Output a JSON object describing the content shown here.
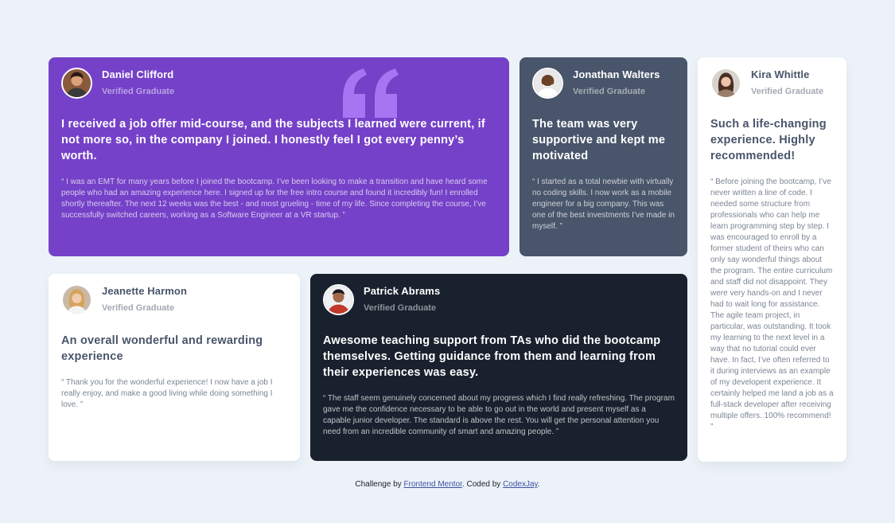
{
  "colors": {
    "background": "#ecf2f8",
    "purple": "#7541c8",
    "slate": "#48556a",
    "dark": "#19212e",
    "white": "#ffffff",
    "link": "#3e52a3",
    "quote_mark": "#a775f1"
  },
  "testimonials": [
    {
      "name": "Daniel Clifford",
      "title": "Verified Graduate",
      "avatar_icon": "avatar-daniel-icon",
      "headline": "I received a job offer mid-course, and the subjects I learned were current, if not more so, in the company I joined. I honestly feel I got every penny’s worth.",
      "quote": "“ I was an EMT for many years before I joined the bootcamp. I’ve been looking to make a transition and have heard some people who had an amazing experience here. I signed up for the free intro course and found it incredibly fun! I enrolled shortly thereafter. The next 12 weeks was the best - and most grueling - time of my life. Since completing the course, I’ve successfully switched careers, working as a Software Engineer at a VR startup. ”"
    },
    {
      "name": "Jonathan Walters",
      "title": "Verified Graduate",
      "avatar_icon": "avatar-jonathan-icon",
      "headline": "The team was very supportive and kept me motivated",
      "quote": "“ I started as a total newbie with virtually no coding skills. I now work as a mobile engineer for a big company. This was one of the best investments I’ve made in myself. ”"
    },
    {
      "name": "Jeanette Harmon",
      "title": "Verified Graduate",
      "avatar_icon": "avatar-jeanette-icon",
      "headline": "An overall wonderful and rewarding experience",
      "quote": "“ Thank you for the wonderful experience! I now have a job I really enjoy, and make a good living while doing something I love. ”"
    },
    {
      "name": "Patrick Abrams",
      "title": "Verified Graduate",
      "avatar_icon": "avatar-patrick-icon",
      "headline": "Awesome teaching support from TAs who did the bootcamp themselves. Getting guidance from them and learning from their experiences was easy.",
      "quote": "“ The staff seem genuinely concerned about my progress which I find really refreshing. The program gave me the confidence necessary to be able to go out in the world and present myself as a capable junior developer. The standard is above the rest. You will get the personal attention you need from an incredible community of smart and amazing people. ”"
    },
    {
      "name": "Kira Whittle",
      "title": "Verified Graduate",
      "avatar_icon": "avatar-kira-icon",
      "headline": "Such a life-changing experience. Highly recommended!",
      "quote": "“ Before joining the bootcamp, I’ve never written a line of code. I needed some structure from professionals who can help me learn programming step by step. I was encouraged to enroll by a former student of theirs who can only say wonderful things about the program. The entire curriculum and staff did not disappoint. They were very hands-on and I never had to wait long for assistance. The agile team project, in particular, was outstanding. It took my learning to the next level in a way that no tutorial could ever have. In fact, I’ve often referred to it during interviews as an example of my developent experience. It certainly helped me land a job as a full-stack developer after receiving multiple offers. 100% recommend! ”"
    }
  ],
  "footer": {
    "prefix": "Challenge by ",
    "link1": "Frontend Mentor",
    "middle": ". Coded by ",
    "link2": "CodexJay",
    "suffix": "."
  }
}
